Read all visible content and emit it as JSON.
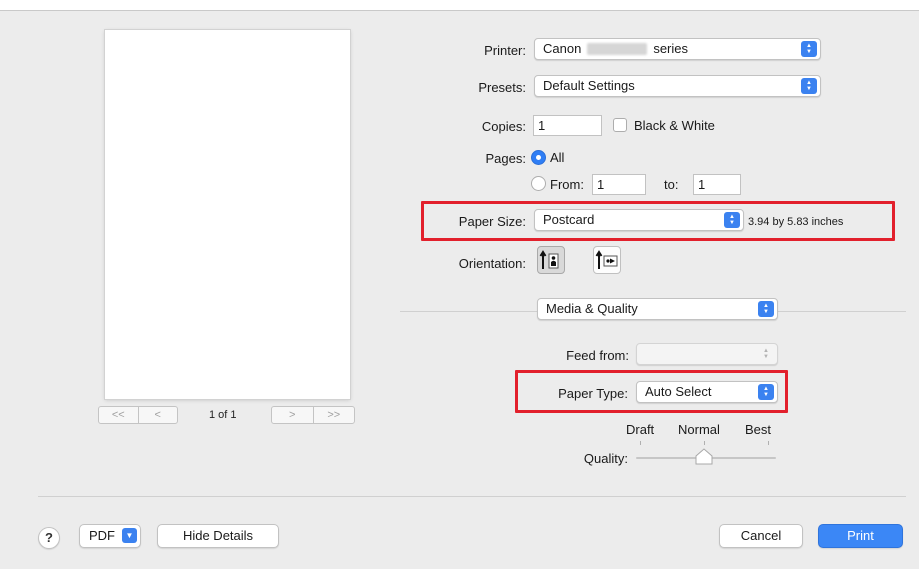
{
  "printer": {
    "label": "Printer:",
    "value_left": "Canon",
    "value_right": "series"
  },
  "presets": {
    "label": "Presets:",
    "value": "Default Settings"
  },
  "copies": {
    "label": "Copies:",
    "value": "1",
    "bw_label": "Black & White"
  },
  "pages": {
    "label": "Pages:",
    "all_label": "All",
    "from_label": "From:",
    "from_value": "1",
    "to_label": "to:",
    "to_value": "1"
  },
  "paper_size": {
    "label": "Paper Size:",
    "value": "Postcard",
    "dimensions": "3.94 by 5.83 inches"
  },
  "orientation": {
    "label": "Orientation:",
    "options": [
      "portrait-icon",
      "landscape-icon"
    ],
    "selected": "portrait-icon"
  },
  "section_menu": {
    "value": "Media & Quality"
  },
  "feed_from": {
    "label": "Feed from:",
    "value": ""
  },
  "paper_type": {
    "label": "Paper Type:",
    "value": "Auto Select"
  },
  "quality": {
    "label": "Quality:",
    "ticks": [
      "Draft",
      "Normal",
      "Best"
    ],
    "selected": "Normal"
  },
  "preview": {
    "page_counter": "1 of 1",
    "nav_first": "<<",
    "nav_prev": "<",
    "nav_next": ">",
    "nav_last": ">>"
  },
  "footer": {
    "help": "?",
    "pdf": "PDF",
    "hide_details": "Hide Details",
    "cancel": "Cancel",
    "print": "Print"
  },
  "colors": {
    "accent": "#3b82f0",
    "highlight": "#e2202c",
    "dialog_bg": "#ececec"
  }
}
